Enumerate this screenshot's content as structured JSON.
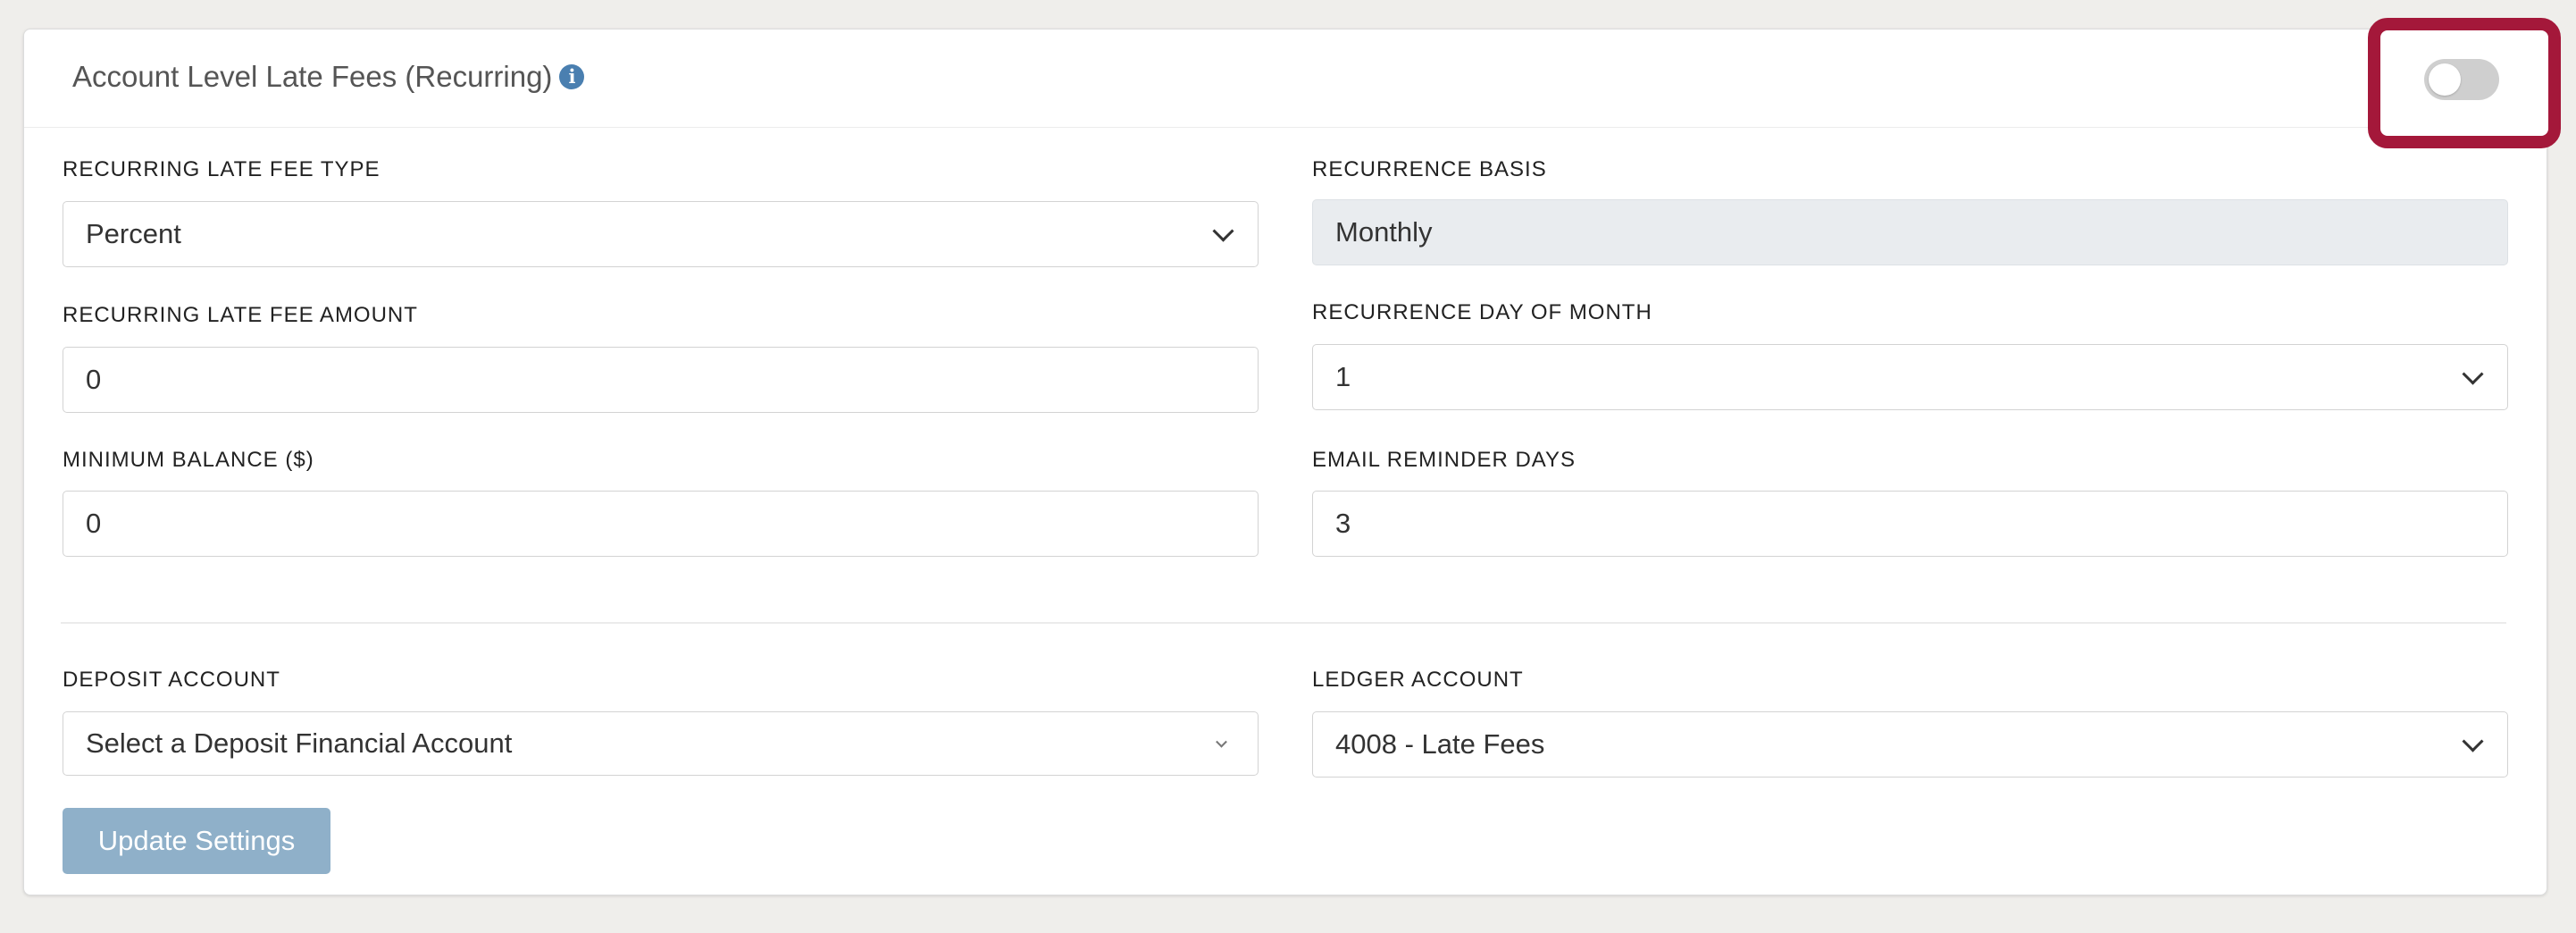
{
  "header": {
    "title": "Account Level Late Fees (Recurring)",
    "info_icon": "i",
    "toggle_enabled": false
  },
  "fields": {
    "late_fee_type": {
      "label": "RECURRING LATE FEE TYPE",
      "value": "Percent"
    },
    "recurrence_basis": {
      "label": "RECURRENCE BASIS",
      "value": "Monthly"
    },
    "late_fee_amount": {
      "label": "RECURRING LATE FEE AMOUNT",
      "value": "0"
    },
    "recurrence_day": {
      "label": "RECURRENCE DAY OF MONTH",
      "value": "1"
    },
    "minimum_balance": {
      "label": "MINIMUM BALANCE ($)",
      "value": "0"
    },
    "email_reminder_days": {
      "label": "EMAIL REMINDER DAYS",
      "value": "3"
    },
    "deposit_account": {
      "label": "DEPOSIT ACCOUNT",
      "value": "Select a Deposit Financial Account"
    },
    "ledger_account": {
      "label": "LEDGER ACCOUNT",
      "value": "4008 - Late Fees"
    }
  },
  "actions": {
    "update_label": "Update Settings"
  },
  "colors": {
    "highlight": "#a4183a",
    "button": "#8fb0c9",
    "info_icon": "#4a7fb0"
  }
}
